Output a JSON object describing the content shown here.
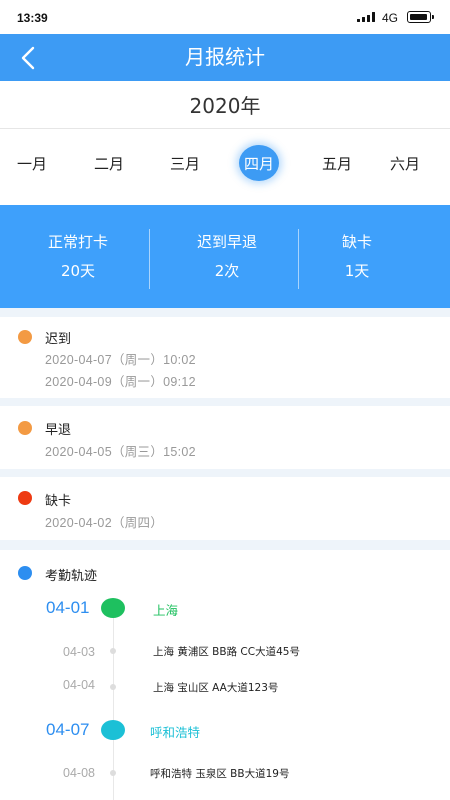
{
  "status_bar": {
    "time": "13:39",
    "network": "4G",
    "icons": [
      "signal-icon",
      "battery-icon"
    ]
  },
  "nav": {
    "title": "月报统计",
    "back_icon": "back-arrow-icon"
  },
  "year": "2020年",
  "months": [
    {
      "label": "一月",
      "active": false
    },
    {
      "label": "二月",
      "active": false
    },
    {
      "label": "三月",
      "active": false
    },
    {
      "label": "四月",
      "active": true
    },
    {
      "label": "五月",
      "active": false
    },
    {
      "label": "六月",
      "active": false
    }
  ],
  "summary": [
    {
      "label": "正常打卡",
      "value": "20天"
    },
    {
      "label": "迟到早退",
      "value": "2次"
    },
    {
      "label": "缺卡",
      "value": "1天"
    }
  ],
  "records": {
    "late": {
      "title": "迟到",
      "color": "#f39a43",
      "entries": [
        "2020-04-07（周一）10:02",
        "2020-04-09（周一）09:12"
      ]
    },
    "early": {
      "title": "早退",
      "color": "#f39a43",
      "entries": [
        "2020-04-05（周三）15:02"
      ]
    },
    "missing": {
      "title": "缺卡",
      "color": "#ee3a12",
      "entries": [
        "2020-04-02（周四）"
      ]
    }
  },
  "track": {
    "title": "考勤轨迹",
    "color": "#2d8ef0",
    "groups": [
      {
        "date": "04-01",
        "city": "上海",
        "node_color": "#1ec05f",
        "items": [
          {
            "date": "04-03",
            "address": "上海 黄浦区 BB路 CC大道45号"
          },
          {
            "date": "04-04",
            "address": "上海 宝山区 AA大道123号"
          }
        ]
      },
      {
        "date": "04-07",
        "city": "呼和浩特",
        "node_color": "#1cc0d6",
        "items": [
          {
            "date": "04-08",
            "address": "呼和浩特 玉泉区 BB大道19号"
          }
        ]
      }
    ]
  },
  "colors": {
    "primary": "#3d9bf4",
    "summary_bg": "#3ea0fb",
    "section_gap": "#eef4fa"
  }
}
